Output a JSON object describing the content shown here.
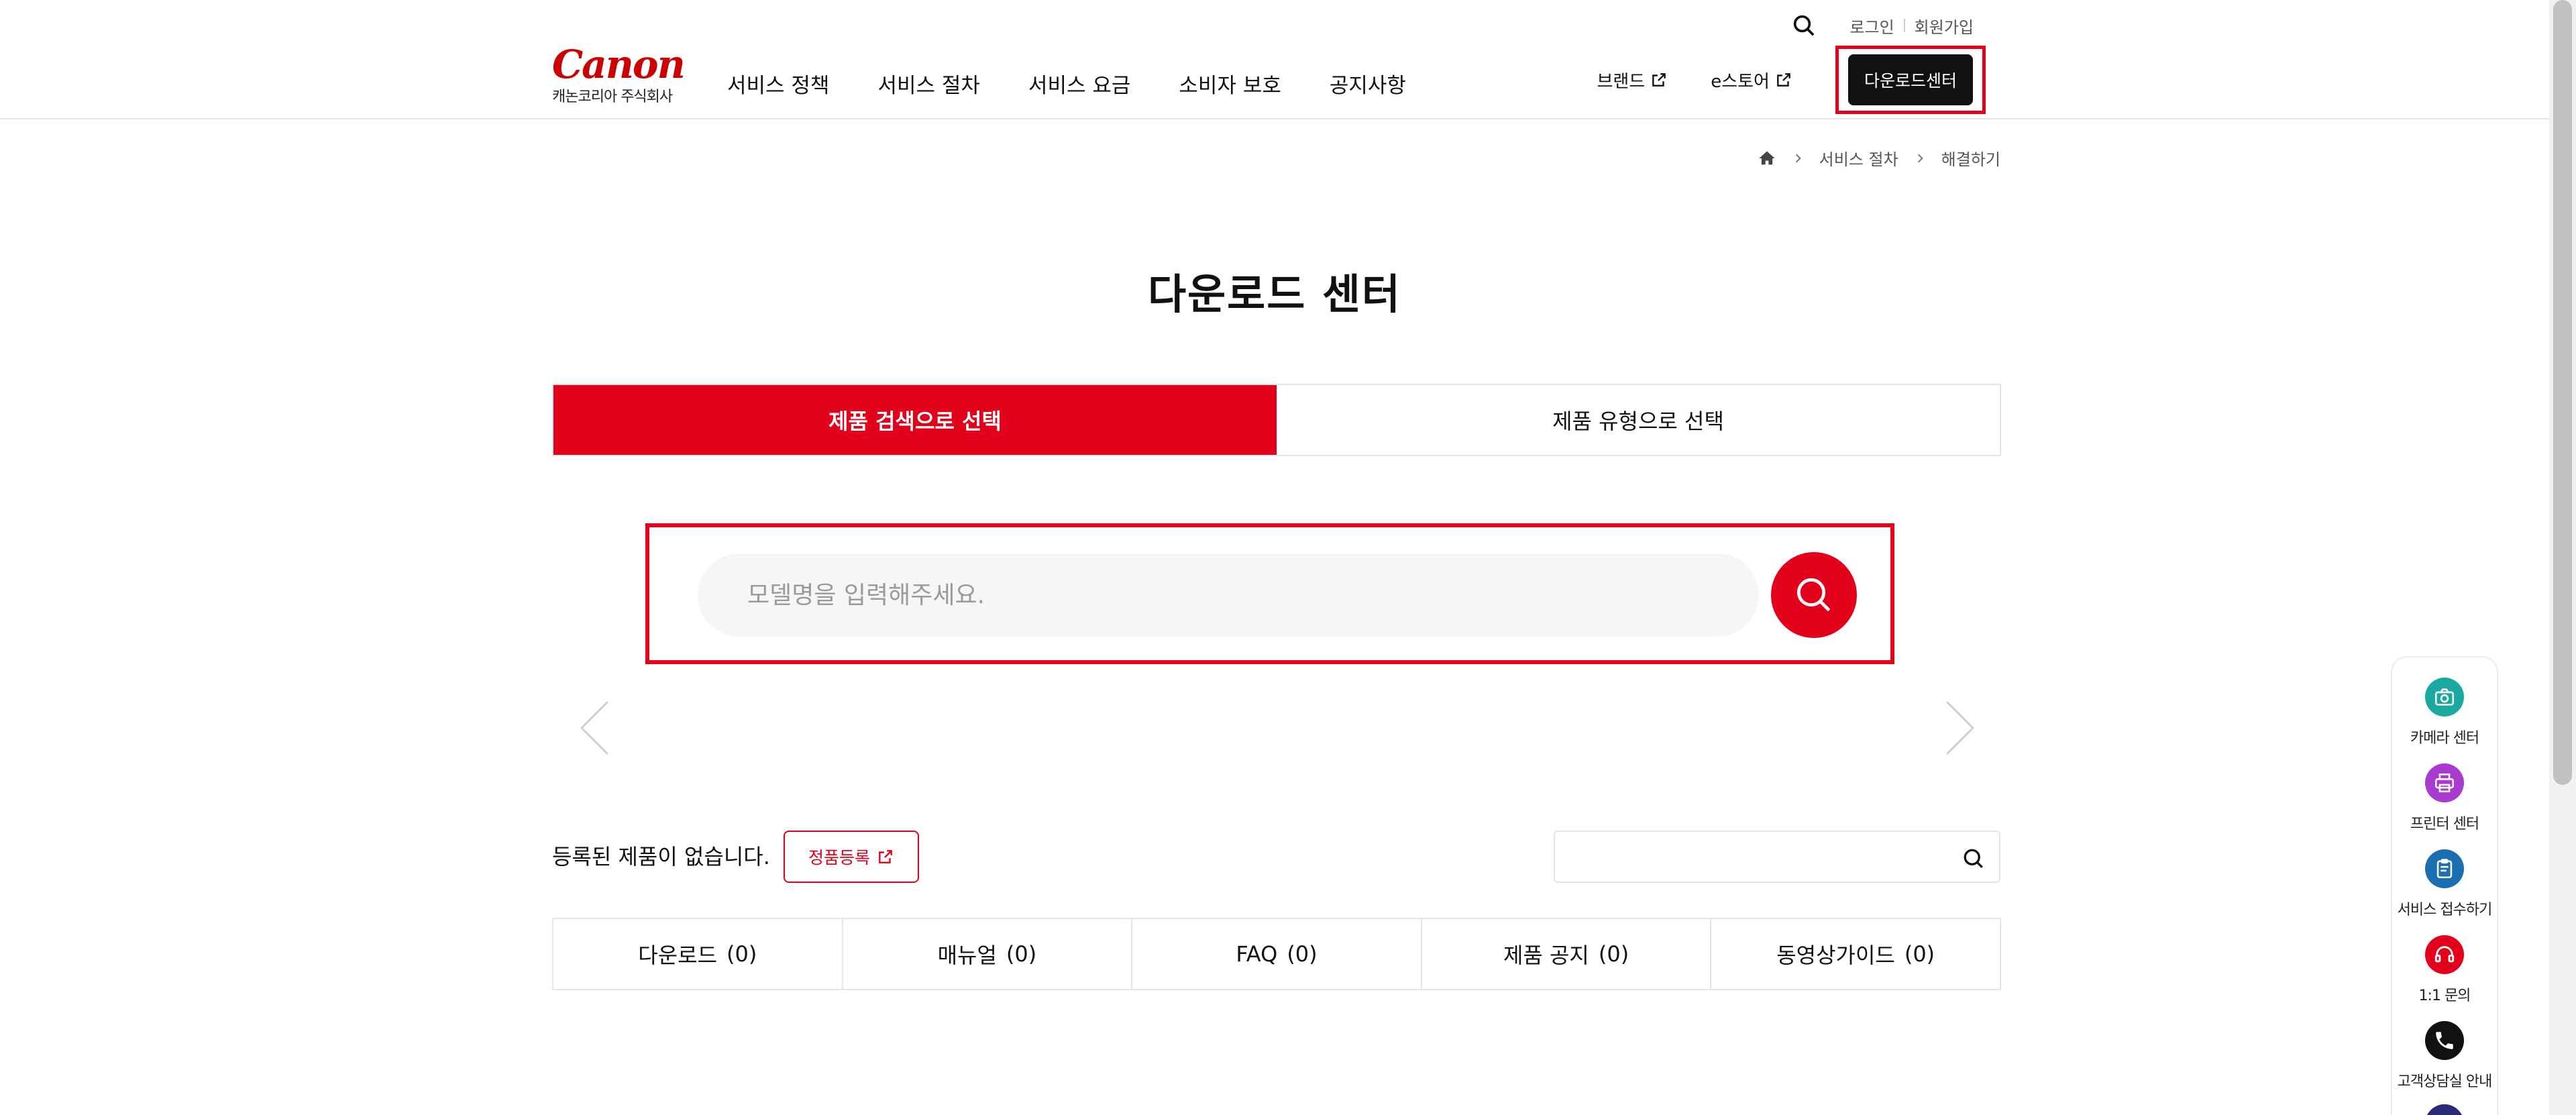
{
  "brand": {
    "logo": "Canon",
    "company": "캐논코리아 주식회사"
  },
  "util": {
    "login": "로그인",
    "signup": "회원가입"
  },
  "gnb": [
    "서비스 정책",
    "서비스 절차",
    "서비스 요금",
    "소비자 보호",
    "공지사항"
  ],
  "right_nav": {
    "brand": "브랜드",
    "estore": "e스토어",
    "download_center": "다운로드센터"
  },
  "breadcrumb": {
    "level1": "서비스 절차",
    "level2": "해결하기"
  },
  "page_title": "다운로드 센터",
  "tabs": {
    "search": "제품 검색으로 선택",
    "type": "제품 유형으로 선택"
  },
  "search": {
    "placeholder": "모델명을 입력해주세요."
  },
  "product": {
    "none_message": "등록된 제품이 없습니다.",
    "register": "정품등록"
  },
  "content_tabs": [
    {
      "label": "다운로드",
      "count": "(0)"
    },
    {
      "label": "매뉴얼",
      "count": "(0)"
    },
    {
      "label": "FAQ",
      "count": "(0)"
    },
    {
      "label": "제품 공지",
      "count": "(0)"
    },
    {
      "label": "동영상가이드",
      "count": "(0)"
    }
  ],
  "quick_menu": [
    {
      "label": "카메라 센터",
      "icon": "camera-icon",
      "color": "#1aa9a0"
    },
    {
      "label": "프린터 센터",
      "icon": "printer-icon",
      "color": "#a93bd1"
    },
    {
      "label": "서비스 접수하기",
      "icon": "clipboard-icon",
      "color": "#1b6fb0"
    },
    {
      "label": "1:1 문의",
      "icon": "headset-icon",
      "color": "#e2001a"
    },
    {
      "label": "고객상담실 안내",
      "icon": "phone-icon",
      "color": "#111111"
    }
  ],
  "colors": {
    "accent": "#e2001a",
    "dark": "#111111",
    "border": "#e6e6e6"
  }
}
